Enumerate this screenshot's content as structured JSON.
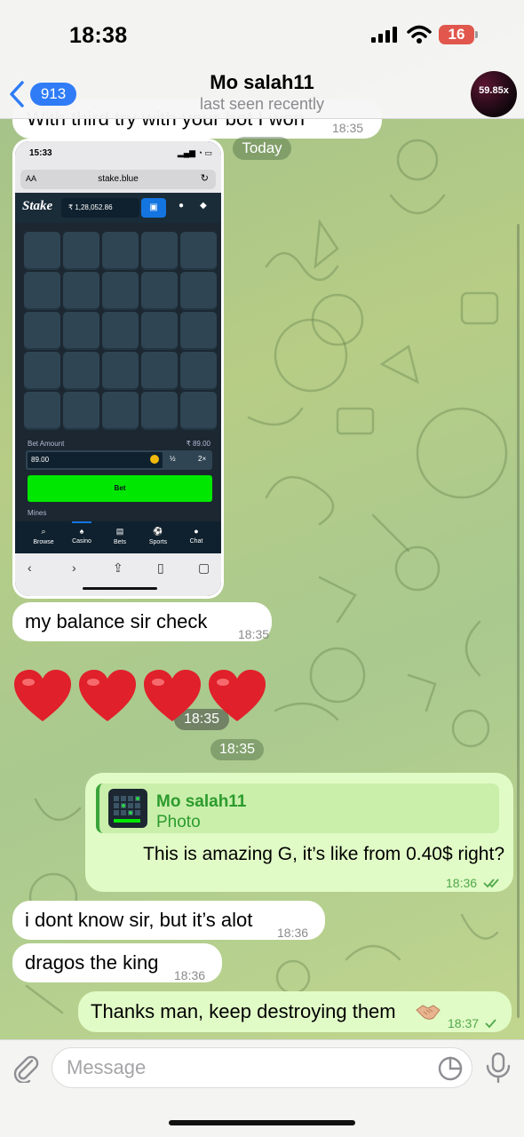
{
  "status_bar": {
    "time": "18:38",
    "battery": "16"
  },
  "header": {
    "back_count": "913",
    "title": "Mo salah11",
    "subtitle": "last seen recently",
    "avatar_text": "59.85x"
  },
  "messages": {
    "partial": {
      "text": "With third try with your bot I won",
      "time": "18:35"
    },
    "date_divider": "Today",
    "photo": {
      "time": "18:35",
      "screenshot": {
        "status_time": "15:33",
        "aa": "AA",
        "url": "stake.blue",
        "logo": "Stake",
        "balance": "₹ 1,28,052.86",
        "bet_amount_label": "Bet Amount",
        "bet_amount_right": "₹ 89.00",
        "bet_amount_value": "89.00",
        "half": "½",
        "double": "2×",
        "bet_button": "Bet",
        "mines_label": "Mines",
        "nav": [
          "Browse",
          "Casino",
          "Bets",
          "Sports",
          "Chat"
        ]
      }
    },
    "m1": {
      "text": "my balance sir check",
      "time": "18:35"
    },
    "hearts_time": "18:35",
    "reply": {
      "quote_name": "Mo salah11",
      "quote_kind": "Photo",
      "text": "This is amazing G, it’s like from 0.40$ right?",
      "time": "18:36"
    },
    "m2": {
      "text": "i dont know sir, but it’s alot",
      "time": "18:36"
    },
    "m3": {
      "text": "dragos the king",
      "time": "18:36"
    },
    "m4": {
      "text": "Thanks man, keep destroying them",
      "time": "18:37"
    }
  },
  "input": {
    "placeholder": "Message"
  },
  "colors": {
    "accent": "#2f7cf6",
    "outgoing": "#e1fbc6",
    "quote_green": "#2c9b2c",
    "stake_green": "#00e701"
  },
  "icons": [
    "back-chevron-icon",
    "signal-icon",
    "wifi-icon",
    "heart-icon",
    "handshake-icon",
    "double-check-icon",
    "check-icon",
    "paperclip-icon",
    "sticker-icon",
    "mic-icon"
  ]
}
